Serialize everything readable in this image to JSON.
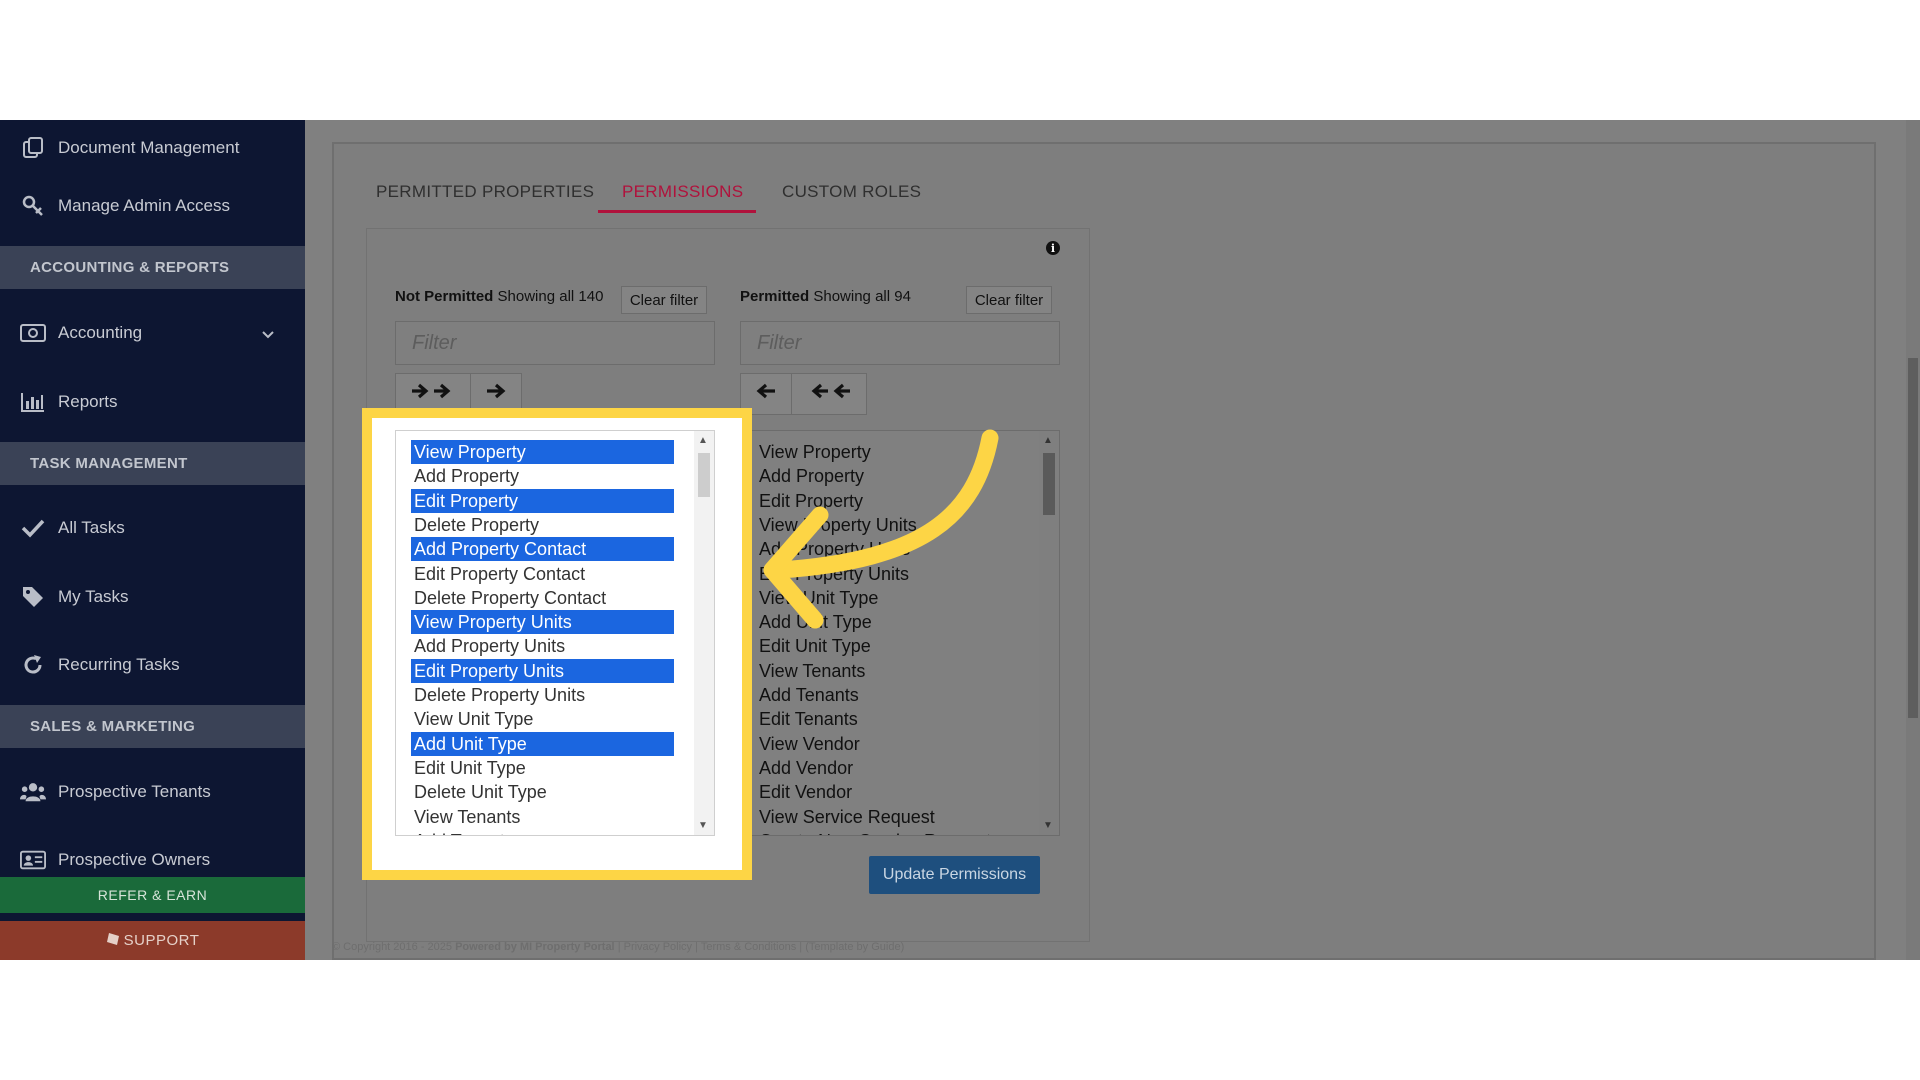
{
  "sidebar": {
    "items": [
      {
        "label": "Document Management",
        "icon": "document-icon"
      },
      {
        "label": "Manage Admin Access",
        "icon": "key-icon"
      },
      {
        "label": "Accounting",
        "icon": "money-icon"
      },
      {
        "label": "Reports",
        "icon": "bar-chart-icon"
      },
      {
        "label": "All Tasks",
        "icon": "check-icon"
      },
      {
        "label": "My Tasks",
        "icon": "tag-icon"
      },
      {
        "label": "Recurring Tasks",
        "icon": "refresh-icon"
      },
      {
        "label": "Prospective Tenants",
        "icon": "users-icon"
      },
      {
        "label": "Prospective Owners",
        "icon": "id-card-icon"
      }
    ],
    "sections": [
      "ACCOUNTING & REPORTS",
      "TASK MANAGEMENT",
      "SALES & MARKETING"
    ],
    "refer_label": "REFER & EARN",
    "support_label": "SUPPORT"
  },
  "tabs": [
    "PERMITTED PROPERTIES",
    "PERMISSIONS",
    "CUSTOM ROLES"
  ],
  "not_permitted": {
    "title": "Not Permitted",
    "count_text": "Showing all 140",
    "clear_label": "Clear filter",
    "filter_placeholder": "Filter",
    "items": [
      {
        "label": "View Property",
        "selected": true
      },
      {
        "label": "Add Property",
        "selected": false
      },
      {
        "label": "Edit Property",
        "selected": true
      },
      {
        "label": "Delete Property",
        "selected": false
      },
      {
        "label": "Add Property Contact",
        "selected": true
      },
      {
        "label": "Edit Property Contact",
        "selected": false
      },
      {
        "label": "Delete Property Contact",
        "selected": false
      },
      {
        "label": "View Property Units",
        "selected": true
      },
      {
        "label": "Add Property Units",
        "selected": false
      },
      {
        "label": "Edit Property Units",
        "selected": true
      },
      {
        "label": "Delete Property Units",
        "selected": false
      },
      {
        "label": "View Unit Type",
        "selected": false
      },
      {
        "label": "Add Unit Type",
        "selected": true
      },
      {
        "label": "Edit Unit Type",
        "selected": false
      },
      {
        "label": "Delete Unit Type",
        "selected": false
      },
      {
        "label": "View Tenants",
        "selected": false
      },
      {
        "label": "Add Tenants",
        "selected": false
      }
    ]
  },
  "permitted": {
    "title": "Permitted",
    "count_text": "Showing all 94",
    "clear_label": "Clear filter",
    "filter_placeholder": "Filter",
    "items": [
      "View Property",
      "Add Property",
      "Edit Property",
      "View Property Units",
      "Add Property Units",
      "Edit Property Units",
      "View Unit Type",
      "Add Unit Type",
      "Edit Unit Type",
      "View Tenants",
      "Add Tenants",
      "Edit Tenants",
      "View Vendor",
      "Add Vendor",
      "Edit Vendor",
      "View Service Request",
      "Create New Service Request"
    ]
  },
  "update_label": "Update Permissions",
  "footer": {
    "copyright": "© Copyright 2016 - 2025",
    "powered": "Powered by MI Property Portal",
    "links": "| Privacy Policy | Terms & Conditions |",
    "template": "(Template by Guide)"
  },
  "colors": {
    "sidebar_bg": "#0d1632",
    "section_bg": "#3a4256",
    "active_tab": "#b0123c",
    "selection": "#1b66e0",
    "highlight": "#fdd545",
    "refer_bg": "#1a6a3a",
    "support_bg": "#8c3a2a",
    "update_button": "#1e4f7e"
  }
}
